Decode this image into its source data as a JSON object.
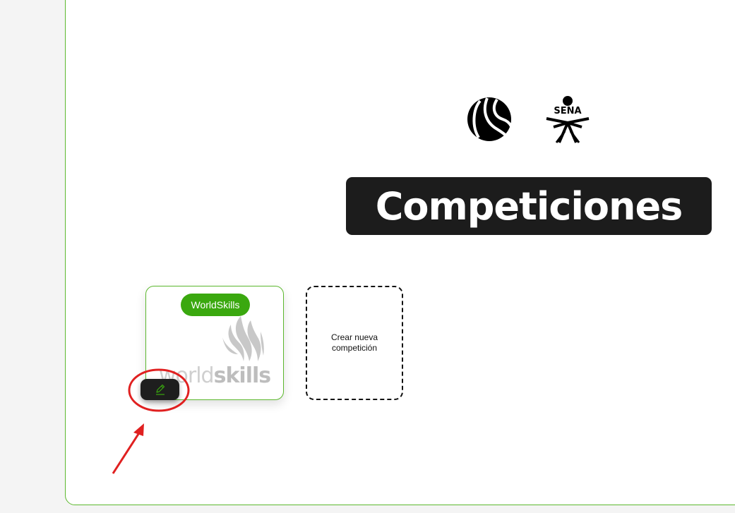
{
  "header": {
    "title": "Competiciones",
    "logos": [
      {
        "icon": "circular-emblem-logo"
      },
      {
        "icon": "sena-logo",
        "text": "SENA"
      }
    ]
  },
  "competitions": [
    {
      "name": "WorldSkills",
      "logo_text": "worldskills",
      "edit_icon": "pencil-icon"
    }
  ],
  "new_competition": {
    "label": "Crear nueva competición"
  },
  "colors": {
    "accent": "#3aa80f",
    "panel_border": "#5cb82e",
    "title_bg": "#1c1c1c",
    "edit_icon": "#3aa80f",
    "annotation": "#e02020"
  }
}
